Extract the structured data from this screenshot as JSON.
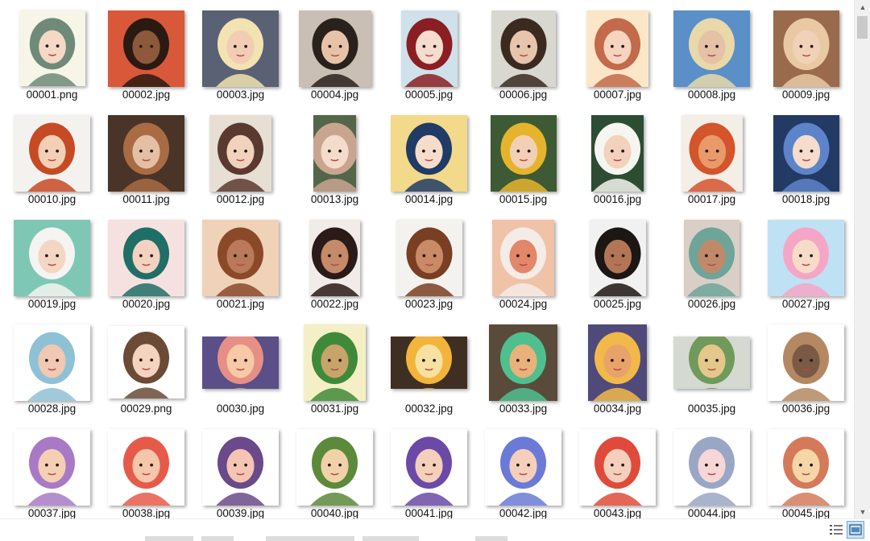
{
  "files": [
    {
      "name": "00001.png",
      "w": 82,
      "h": 94,
      "bg": "#f7f4e8",
      "fg": "#6f8a78",
      "skin": "#f4d9c6"
    },
    {
      "name": "00002.jpg",
      "w": 95,
      "h": 95,
      "bg": "#d9583a",
      "fg": "#2b1a12",
      "skin": "#8c5a3a"
    },
    {
      "name": "00003.jpg",
      "w": 95,
      "h": 95,
      "bg": "#5a6174",
      "fg": "#f2e3b0",
      "skin": "#f2cdb4"
    },
    {
      "name": "00004.jpg",
      "w": 90,
      "h": 95,
      "bg": "#c9bfb4",
      "fg": "#2a211c",
      "skin": "#e6c3a8"
    },
    {
      "name": "00005.jpg",
      "w": 70,
      "h": 95,
      "bg": "#cfe1ea",
      "fg": "#8b1e22",
      "skin": "#f6dccd"
    },
    {
      "name": "00006.jpg",
      "w": 80,
      "h": 95,
      "bg": "#d8d8d0",
      "fg": "#3a2a20",
      "skin": "#e7c4ac"
    },
    {
      "name": "00007.jpg",
      "w": 77,
      "h": 95,
      "bg": "#fbe7c8",
      "fg": "#c26a4a",
      "skin": "#f6d4c0"
    },
    {
      "name": "00008.jpg",
      "w": 95,
      "h": 95,
      "bg": "#5a8fc8",
      "fg": "#e9d9a8",
      "skin": "#e5c1a6"
    },
    {
      "name": "00009.jpg",
      "w": 82,
      "h": 95,
      "bg": "#9a6a4c",
      "fg": "#e9c9a3",
      "skin": "#f0d2b8"
    },
    {
      "name": "00010.jpg",
      "w": 95,
      "h": 95,
      "bg": "#f4f2ee",
      "fg": "#c64a24",
      "skin": "#f3cfb5"
    },
    {
      "name": "00011.jpg",
      "w": 95,
      "h": 95,
      "bg": "#4a3428",
      "fg": "#a96b44",
      "skin": "#e4bfa4"
    },
    {
      "name": "00012.jpg",
      "w": 77,
      "h": 95,
      "bg": "#e7dfd3",
      "fg": "#5a3a30",
      "skin": "#f0d2bd"
    },
    {
      "name": "00013.jpg",
      "w": 53,
      "h": 95,
      "bg": "#53664a",
      "fg": "#c9a590",
      "skin": "#f3dccb"
    },
    {
      "name": "00014.jpg",
      "w": 95,
      "h": 95,
      "bg": "#f3d98a",
      "fg": "#1f3b66",
      "skin": "#f6dccb"
    },
    {
      "name": "00015.jpg",
      "w": 82,
      "h": 95,
      "bg": "#3d5a35",
      "fg": "#e6b42c",
      "skin": "#f2d0b6"
    },
    {
      "name": "00016.jpg",
      "w": 65,
      "h": 95,
      "bg": "#2c4d32",
      "fg": "#f6f6f0",
      "skin": "#f2d2bc"
    },
    {
      "name": "00017.jpg",
      "w": 76,
      "h": 95,
      "bg": "#f3eee6",
      "fg": "#d4542c",
      "skin": "#e99a6a"
    },
    {
      "name": "00018.jpg",
      "w": 82,
      "h": 95,
      "bg": "#233a64",
      "fg": "#5d84c9",
      "skin": "#f5dccc"
    },
    {
      "name": "00019.jpg",
      "w": 95,
      "h": 95,
      "bg": "#7fc7b5",
      "fg": "#f4f4f2",
      "skin": "#f4d6c4"
    },
    {
      "name": "00020.jpg",
      "w": 95,
      "h": 95,
      "bg": "#f6e1e1",
      "fg": "#1f6f66",
      "skin": "#f4d2c2"
    },
    {
      "name": "00021.jpg",
      "w": 95,
      "h": 95,
      "bg": "#f0d2b8",
      "fg": "#8a4a2a",
      "skin": "#b9795a"
    },
    {
      "name": "00022.jpg",
      "w": 63,
      "h": 95,
      "bg": "#f1ece8",
      "fg": "#2a1a18",
      "skin": "#c58a6a"
    },
    {
      "name": "00023.jpg",
      "w": 82,
      "h": 95,
      "bg": "#f4f2ef",
      "fg": "#7a3e22",
      "skin": "#c98a66"
    },
    {
      "name": "00024.jpg",
      "w": 77,
      "h": 95,
      "bg": "#f0c2a8",
      "fg": "#f4ece6",
      "skin": "#e2876a"
    },
    {
      "name": "00025.jpg",
      "w": 70,
      "h": 95,
      "bg": "#f1f1f1",
      "fg": "#1c1614",
      "skin": "#b27656"
    },
    {
      "name": "00026.jpg",
      "w": 69,
      "h": 95,
      "bg": "#d9cfc6",
      "fg": "#6fa49a",
      "skin": "#c08a6a"
    },
    {
      "name": "00027.jpg",
      "w": 95,
      "h": 95,
      "bg": "#bfe1f4",
      "fg": "#f5a6c6",
      "skin": "#f6dcc8"
    },
    {
      "name": "00028.jpg",
      "w": 95,
      "h": 95,
      "bg": "#ffffff",
      "fg": "#8fc1d6",
      "skin": "#f0c8b4"
    },
    {
      "name": "00029.png",
      "w": 95,
      "h": 90,
      "bg": "#ffffff",
      "fg": "#6b4a36",
      "skin": "#f4d4bf"
    },
    {
      "name": "00030.jpg",
      "w": 95,
      "h": 65,
      "bg": "#5a4f86",
      "fg": "#e58f86",
      "skin": "#f7c9a6"
    },
    {
      "name": "00031.jpg",
      "w": 77,
      "h": 95,
      "bg": "#f5efc6",
      "fg": "#3f8a3a",
      "skin": "#c7a46a"
    },
    {
      "name": "00032.jpg",
      "w": 95,
      "h": 65,
      "bg": "#3f2f22",
      "fg": "#f2b43a",
      "skin": "#f7e1a0"
    },
    {
      "name": "00033.jpg",
      "w": 85,
      "h": 95,
      "bg": "#5a4a3a",
      "fg": "#4fbf8f",
      "skin": "#e8b27a"
    },
    {
      "name": "00034.jpg",
      "w": 73,
      "h": 95,
      "bg": "#4f4a7a",
      "fg": "#f2b84a",
      "skin": "#e8a36a"
    },
    {
      "name": "00035.jpg",
      "w": 95,
      "h": 65,
      "bg": "#d4d9d2",
      "fg": "#6f9a5a",
      "skin": "#e4c78a"
    },
    {
      "name": "00036.jpg",
      "w": 95,
      "h": 95,
      "bg": "#ffffff",
      "fg": "#b48862",
      "skin": "#7a5a44"
    },
    {
      "name": "00037.jpg",
      "w": 95,
      "h": 95,
      "bg": "#ffffff",
      "fg": "#a87ac6",
      "skin": "#f4cfb4"
    },
    {
      "name": "00038.jpg",
      "w": 95,
      "h": 95,
      "bg": "#ffffff",
      "fg": "#e65a4a",
      "skin": "#f4c6ac"
    },
    {
      "name": "00039.jpg",
      "w": 95,
      "h": 95,
      "bg": "#ffffff",
      "fg": "#6a4a8a",
      "skin": "#f6c4b4"
    },
    {
      "name": "00040.jpg",
      "w": 95,
      "h": 95,
      "bg": "#ffffff",
      "fg": "#5a8a3a",
      "skin": "#f1d2a8"
    },
    {
      "name": "00041.jpg",
      "w": 95,
      "h": 95,
      "bg": "#ffffff",
      "fg": "#6a4aa6",
      "skin": "#f4d0bc"
    },
    {
      "name": "00042.jpg",
      "w": 95,
      "h": 95,
      "bg": "#ffffff",
      "fg": "#6a7ad6",
      "skin": "#f4d0bc"
    },
    {
      "name": "00043.jpg",
      "w": 95,
      "h": 95,
      "bg": "#ffffff",
      "fg": "#e04a3a",
      "skin": "#f4d0bc"
    },
    {
      "name": "00044.jpg",
      "w": 95,
      "h": 95,
      "bg": "#ffffff",
      "fg": "#9aa6c6",
      "skin": "#f6d6d6"
    },
    {
      "name": "00045.jpg",
      "w": 95,
      "h": 95,
      "bg": "#ffffff",
      "fg": "#d47a5a",
      "skin": "#f4d6a8"
    }
  ],
  "view_buttons": {
    "details": "details-view-icon",
    "large_icons": "large-icons-view-icon"
  },
  "accent": "#cce4f7"
}
